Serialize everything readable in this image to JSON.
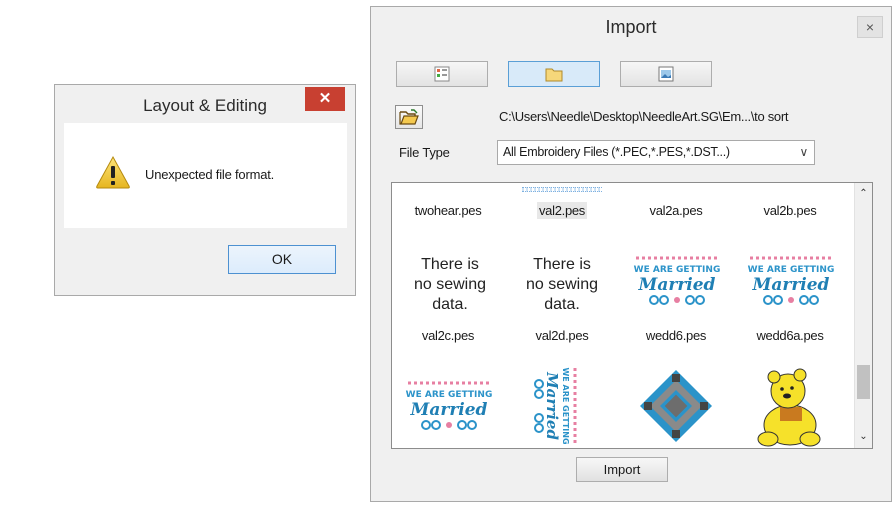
{
  "import_dialog": {
    "title": "Import",
    "close_label": "×",
    "path": "C:\\Users\\Needle\\Desktop\\NeedleArt.SG\\Em...\\to sort",
    "file_type_label": "File Type",
    "file_type_value": "All Embroidery Files (*.PEC,*.PES,*.DST...)",
    "import_button": "Import",
    "files_row1": [
      "twohear.pes",
      "val2.pes",
      "val2a.pes",
      "val2b.pes"
    ],
    "no_data_text": [
      "There is",
      "no sewing",
      "data."
    ],
    "files_row2": [
      "val2c.pes",
      "val2d.pes",
      "wedd6.pes",
      "wedd6a.pes"
    ],
    "embroidery_text": {
      "line1": "WE ARE GETTING",
      "line2": "Married"
    }
  },
  "layout_dialog": {
    "title": "Layout & Editing",
    "close_label": "✕",
    "message": "Unexpected file format.",
    "ok_label": "OK"
  },
  "colors": {
    "accent": "#5a9fd6",
    "close_red": "#c84031",
    "stitch_blue": "#2b93c9",
    "stitch_pink": "#e77fa2"
  },
  "icons": [
    "list-view-icon",
    "folder-icon",
    "thumbnail-view-icon",
    "open-folder-icon",
    "warning-icon",
    "scroll-up-icon",
    "scroll-down-icon",
    "dropdown-arrow-icon"
  ]
}
